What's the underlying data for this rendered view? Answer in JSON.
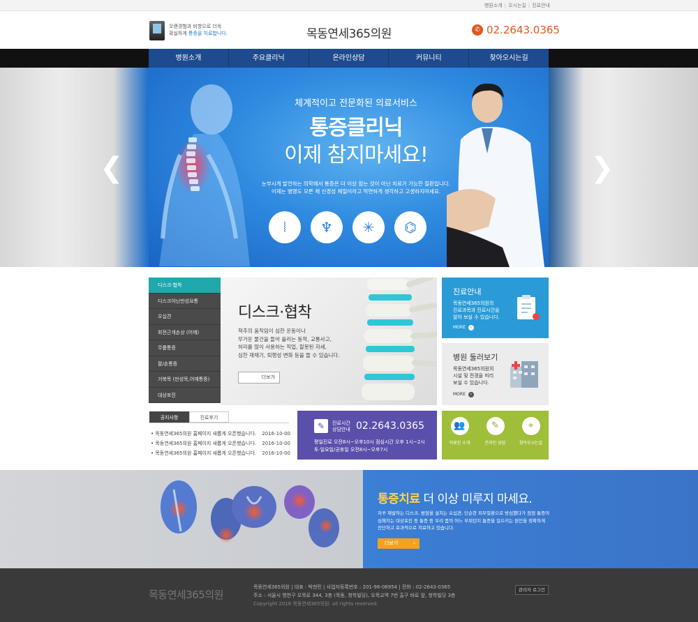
{
  "util_links": [
    "병원소개",
    "오시는길",
    "진료안내"
  ],
  "header": {
    "tagline_line1": "오랜경험과 비향으로 더욱",
    "tagline_line2_prefix": "확실하게 ",
    "tagline_line2_highlight": "통증을 치료합니다.",
    "site_title": "목동연세365의원",
    "phone": "02.2643.0365"
  },
  "gnb": [
    "병원소개",
    "주요클리닉",
    "온라인상담",
    "커뮤니티",
    "찾아오시는길"
  ],
  "hero": {
    "subtitle": "체계적이고 전문화된 의료서비스",
    "title_line1": "통증클리닉",
    "title_line2": "이제 참지마세요!",
    "desc_line1": "눈부시게 발전하는 의학에서 통증은 더 이상 참는 것이 아닌 치료가 가능한 질환입니다.",
    "desc_line2": "이제는 병명도 모른 채 신경성 체질이라고 막연하게 생각하고 고생하지마세요.",
    "icons": [
      "spine-icon",
      "pelvis-icon",
      "nerve-icon",
      "shoulder-icon"
    ]
  },
  "categories": [
    "디스크·협착",
    "디스크아닌만성요통",
    "오십견",
    "회전근개손상 (어깨)",
    "무릎통증",
    "팔/손통증",
    "거북목 (만성목,어깨통증)",
    "대상포진"
  ],
  "feature": {
    "title": "디스크·협착",
    "text_line1": "척추의 움직임이 심한 운동이나",
    "text_line2": "무거운 물건을 들어 올리는 동작, 교통사고,",
    "text_line3": "허리를 많이 사용하는 직업, 잘못된 자세,",
    "text_line4": "심한 재채기, 퇴행성 변화 등을 들 수 있습니다.",
    "more": "더보기"
  },
  "cards": {
    "info": {
      "title": "진료안내",
      "text_line1": "목동연세365의원의",
      "text_line2": "진료과목과 진료시간을",
      "text_line3": "알아 보실 수 있습니다.",
      "more": "MORE"
    },
    "tour": {
      "title": "병원 둘러보기",
      "text_line1": "목동연세365의원의",
      "text_line2": "시설 및 전경을 미리",
      "text_line3": "보실 수 있습니다.",
      "more": "MORE"
    }
  },
  "tabs": [
    "공지사항",
    "진료후기"
  ],
  "notices": [
    {
      "title": "목동연세365의원 홈페이지 새롭게 오픈했습니다.",
      "date": "2016-10-00"
    },
    {
      "title": "목동연세365의원 홈페이지 새롭게 오픈했습니다.",
      "date": "2016-10-00"
    },
    {
      "title": "목동연세365의원 홈페이지 새롭게 오픈했습니다.",
      "date": "2016-10-00"
    }
  ],
  "consult": {
    "label_line1": "진료시간",
    "label_line2": "상담안내",
    "phone": "02.2643.0365",
    "hours_line1": "평일진료  오전8시~오후10시     점심시간 오후 1시~2시",
    "hours_line2": "토·일요일/공휴일 오전8시~오후7시"
  },
  "quick": [
    {
      "icon": "people-icon",
      "label": "의료진 소개"
    },
    {
      "icon": "pencil-icon",
      "label": "온라인 상담"
    },
    {
      "icon": "location-pin-icon",
      "label": "찾아오시는길"
    }
  ],
  "banner": {
    "title_bold": "통증치료",
    "title_rest": " 더 이상 미루지 마세요.",
    "text_line1": "자꾸 재발하는 디스크, 밤잠을 설치는 오십견, 단순한 피부질환으로 방심했다가 점점 통증이",
    "text_line2": "심해지는 대상포진 등 통증 등 우리 몸의 어느 부위던지 통증을 일으키는 원인을 정확하게",
    "text_line3": "진단하고 효과적으로 치료하고 있습니다.",
    "more": "더보기"
  },
  "footer": {
    "logo": "목동연세365의원",
    "line1": "목동연세365의원  |  대표 : 박현민  |  사업자등록번호 : 201-96-06954  |  전화 : 02-2643-0365",
    "line2": "주소 : 서울시 영천구 오목로 344, 3층 (목동, 청학빌딩), 오목교역 7번 출구 바로 앞, 청학빌딩 3층",
    "copyright": "Copyright 2016 목동연세365의원. all rights reserved.",
    "admin": "관리자 로그인"
  },
  "colors": {
    "nav_blue": "#1e4a8f",
    "teal": "#20a8ad",
    "sky": "#2a9bd6",
    "purple": "#5a4faa",
    "lime": "#9fbf3a",
    "orange": "#e0561f"
  }
}
